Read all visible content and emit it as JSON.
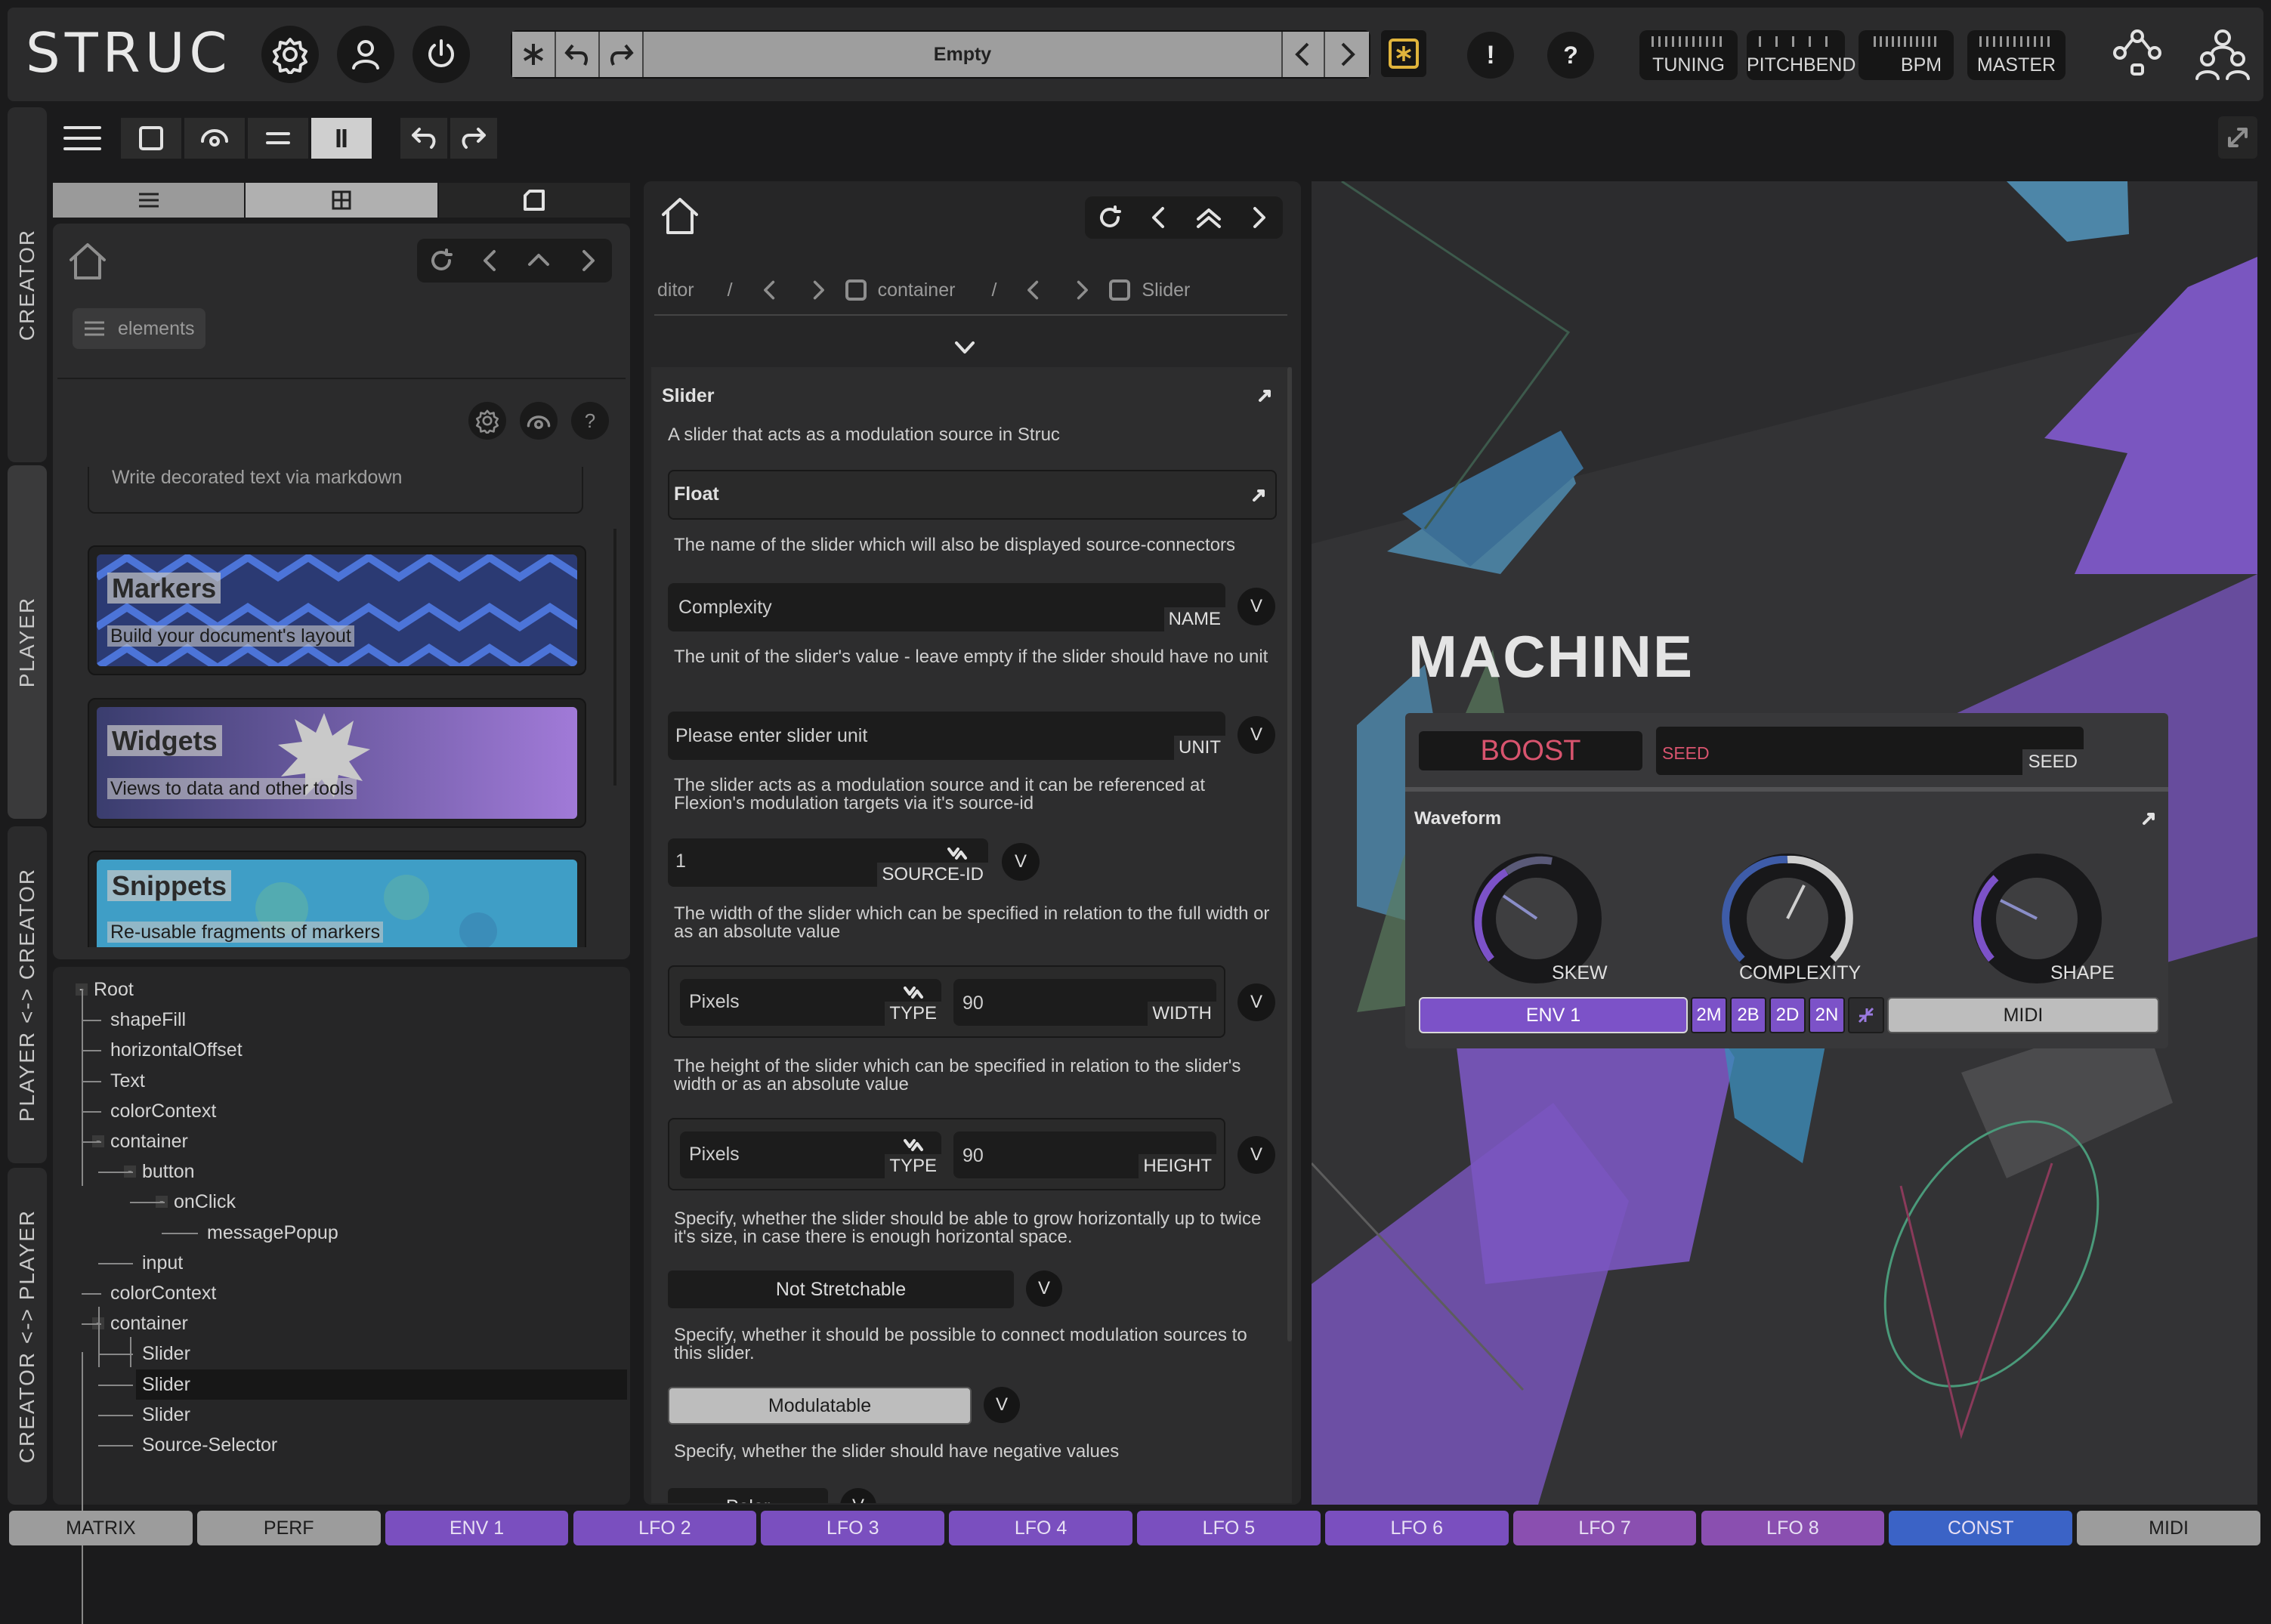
{
  "app": {
    "logo": "STRUC",
    "preset_name": "Empty"
  },
  "top": {
    "meters": [
      "TUNING",
      "PITCHBEND",
      "BPM",
      "MASTER"
    ]
  },
  "sidetabs": [
    "CREATOR",
    "PLAYER",
    "PLAYER <-> CREATOR",
    "CREATOR <-> PLAYER"
  ],
  "library": {
    "search_label": "elements",
    "partial_text": "Write decorated text via markdown",
    "cards": [
      {
        "title": "Markers",
        "subtitle": "Build your document's layout"
      },
      {
        "title": "Widgets",
        "subtitle": "Views to data and other tools"
      },
      {
        "title": "Snippets",
        "subtitle": "Re-usable fragments of markers"
      }
    ]
  },
  "tree": [
    {
      "label": "Root",
      "level": 0,
      "toggle": "-"
    },
    {
      "label": "shapeFill",
      "level": 1
    },
    {
      "label": "horizontalOffset",
      "level": 1
    },
    {
      "label": "Text",
      "level": 1
    },
    {
      "label": "colorContext",
      "level": 1
    },
    {
      "label": "container",
      "level": 1,
      "toggle": "-"
    },
    {
      "label": "button",
      "level": 2,
      "toggle": "-"
    },
    {
      "label": "onClick",
      "level": 3,
      "toggle": "-"
    },
    {
      "label": "messagePopup",
      "level": 4
    },
    {
      "label": "input",
      "level": 2
    },
    {
      "label": "colorContext",
      "level": 1
    },
    {
      "label": "container",
      "level": 1,
      "toggle": "-"
    },
    {
      "label": "Slider",
      "level": 2
    },
    {
      "label": "Slider",
      "level": 2,
      "selected": true
    },
    {
      "label": "Slider",
      "level": 2
    },
    {
      "label": "Source-Selector",
      "level": 2
    }
  ],
  "editor": {
    "breadcrumb": [
      "ditor",
      "/",
      "container",
      "/",
      "Slider"
    ],
    "section_title": "Slider",
    "section_desc": "A slider that acts as a modulation source in Struc",
    "float_title": "Float",
    "name_desc": "The name of the slider which will also be displayed source-connectors",
    "name_value": "Complexity",
    "name_label": "NAME",
    "unit_desc": "The unit of the slider's value - leave empty if the slider should have no unit",
    "unit_placeholder": "Please enter slider unit",
    "unit_label": "UNIT",
    "source_desc": "The slider acts as a modulation source and it can be referenced at Flexion's modulation targets via it's source-id",
    "source_value": "1",
    "source_label": "SOURCE-ID",
    "width_desc": "The width of the slider which can be specified in relation to the full width or as an absolute value",
    "width_type": "Pixels",
    "type_label": "TYPE",
    "width_value": "90",
    "width_label": "WIDTH",
    "height_desc": "The height of the slider which can be specified in relation to the slider's width or as an absolute value",
    "height_type": "Pixels",
    "height_value": "90",
    "height_label": "HEIGHT",
    "stretch_desc": "Specify, whether the slider should be able to grow horizontally up to twice it's size, in case there is enough horizontal space.",
    "stretch_value": "Not Stretchable",
    "mod_desc": "Specify, whether it should be possible to connect modulation sources to this slider.",
    "mod_value": "Modulatable",
    "polar_desc": "Specify, whether the slider should have negative values",
    "polar_value": "Polar",
    "v": "V"
  },
  "preview": {
    "title": "MACHINE",
    "boost": "BOOST",
    "seed_placeholder": "SEED",
    "seed_label": "SEED",
    "waveform_title": "Waveform",
    "knobs": [
      {
        "label": "SKEW"
      },
      {
        "label": "COMPLEXITY"
      },
      {
        "label": "SHAPE"
      }
    ],
    "source_button": "ENV 1",
    "mini_buttons": [
      "2M",
      "2B",
      "2D",
      "2N"
    ],
    "midi_button": "MIDI"
  },
  "bottom_tabs": [
    {
      "label": "MATRIX",
      "color": "#9c9c9c"
    },
    {
      "label": "PERF",
      "color": "#9c9c9c"
    },
    {
      "label": "ENV 1",
      "color": "#7a4fbf"
    },
    {
      "label": "LFO 2",
      "color": "#7a4fbf"
    },
    {
      "label": "LFO 3",
      "color": "#7a4fbf"
    },
    {
      "label": "LFO 4",
      "color": "#7a4fbf"
    },
    {
      "label": "LFO 5",
      "color": "#7a4fbf"
    },
    {
      "label": "LFO 6",
      "color": "#7a4fbf"
    },
    {
      "label": "LFO 7",
      "color": "#8a4fb0"
    },
    {
      "label": "LFO 8",
      "color": "#8a4fb0"
    },
    {
      "label": "CONST",
      "color": "#3b63c6"
    },
    {
      "label": "MIDI",
      "color": "#9c9c9c"
    }
  ],
  "colors": {
    "accent_purple": "#7c52c8",
    "boost": "#d8546e",
    "preset_bar": "#9e9e9e"
  }
}
